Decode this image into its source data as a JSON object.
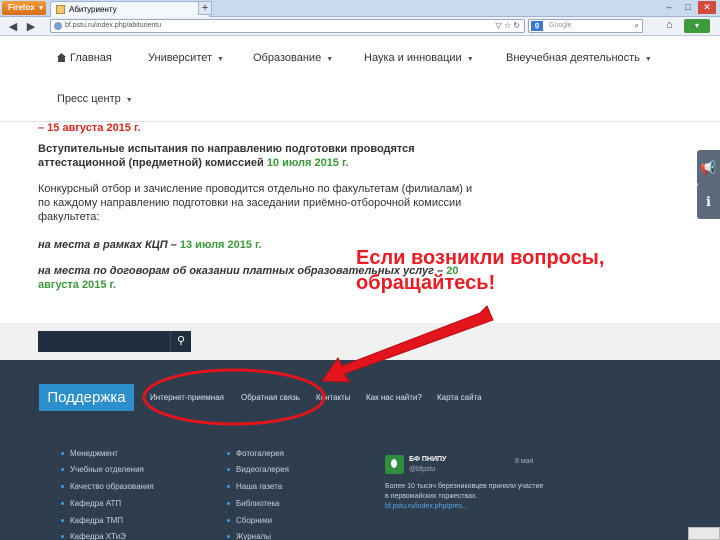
{
  "browser": {
    "app_button": "Firefox",
    "tab_title": "Абитуриенту",
    "url": "bf.pstu.ru/index.php/abiturientu",
    "search_placeholder": "Google"
  },
  "site_nav": {
    "items": [
      {
        "label": "Главная"
      },
      {
        "label": "Университет"
      },
      {
        "label": "Образование"
      },
      {
        "label": "Наука и инновации"
      },
      {
        "label": "Внеучебная деятельность"
      },
      {
        "label": "Пресс центр"
      }
    ]
  },
  "content": {
    "line0_prefix": "– 15 августа 2015 г.",
    "p1_line1": "Вступительные испытания по направлению подготовки проводятся",
    "p1_line2_a": "аттестационной (предметной) комиссией",
    "p1_line2_b": "10 июля 2015 г.",
    "p2_line1": "Конкурсный отбор и зачисление проводится отдельно по факультетам (филиалам) и",
    "p2_line2": "по каждому направлению подготовки на заседании приёмно-отборочной комиссии",
    "p2_line3": "факультета:",
    "p3_a": "на места в рамках КЦП –",
    "p3_b": "13 июля 2015 г.",
    "p4_line1_a": "на места по договорам об оказании платных образовательных услуг –",
    "p4_line1_b": "20",
    "p4_line2": "августа 2015 г."
  },
  "callout": {
    "line1": "Если возникли вопросы,",
    "line2": "обращайтесь!"
  },
  "footer": {
    "support_label": "Поддержка",
    "links": [
      "Интернет-приемная",
      "Обратная связь",
      "Контакты",
      "Как нас найти?",
      "Карта сайта"
    ],
    "col1": [
      "Менеджмент",
      "Учебные отделения",
      "Качество образования",
      "Кафедра АТП",
      "Кафедра ТМП",
      "Кафедра ХТиЭ"
    ],
    "col2": [
      "Фотогалерея",
      "Видеогалерея",
      "Наша газета",
      "Библиотека",
      "Сборники",
      "Журналы"
    ],
    "tweet": {
      "name": "БФ ПНИПУ",
      "handle": "@bfpstu",
      "date": "8 мая",
      "text": "Более 10 тысяч березниковцев приняли участие в первомайских торжествах.",
      "link": "bf.pstu.ru/index.php/pres..."
    }
  },
  "colors": {
    "accent_red": "#d7281b",
    "accent_green": "#3a9a3a",
    "footer_bg": "#2e3e4f",
    "support_blue": "#2c8fcb",
    "annotation_red": "#ed1c24"
  }
}
